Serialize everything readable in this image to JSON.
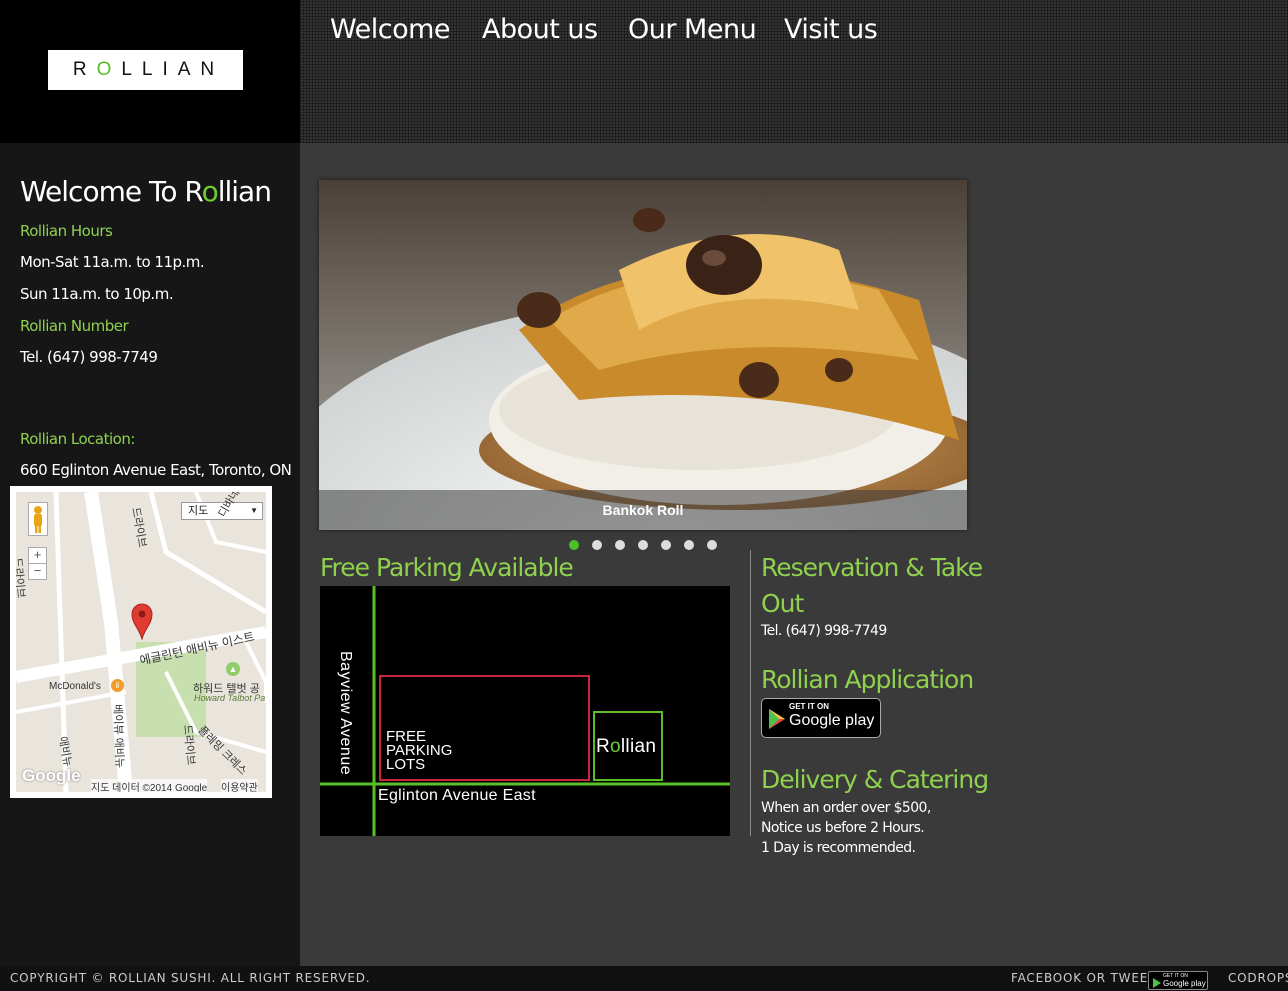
{
  "header": {
    "logo_text_pre": "R",
    "logo_text_o": "O",
    "logo_text_post": "LLIAN",
    "nav": [
      "Welcome",
      "About us",
      "Our Menu",
      "Visit us"
    ]
  },
  "sidebar": {
    "title_pre": "Welcome To R",
    "title_o": "o",
    "title_post": "llian",
    "hours_label": "Rollian Hours",
    "hours_1": "Mon-Sat 11a.m. to 11p.m.",
    "hours_2": "Sun 11a.m. to 10p.m.",
    "number_label": "Rollian Number",
    "phone": "Tel. (647) 998-7749",
    "location_label": "Rollian Location:",
    "address": "660 Eglinton Avenue East, Toronto, ON"
  },
  "map": {
    "type_select": "지도",
    "zoom_in": "+",
    "zoom_out": "−",
    "labels": [
      "드라이브",
      "디바네일",
      "에글린턴 애비뉴 이스트",
      "McDonald's",
      "하워드 텔벗 공",
      "Howard Talbot Pa",
      "베이뷰 애비뉴",
      "플레밍 크레스",
      "드라이브",
      "드라이브",
      "애비뉴"
    ],
    "logo": "Google",
    "attribution": "지도 데이터 ©2014 Google",
    "terms": "이용약관"
  },
  "slider": {
    "caption": "Bankok Roll",
    "dots": 7,
    "active_dot": 0
  },
  "parking": {
    "title": "Free Parking Available",
    "street_vertical": "Bayview Avenue",
    "street_horizontal": "Eglinton Avenue East",
    "lots_line1": "FREE",
    "lots_line2": "PARKING",
    "lots_line3": "LOTS",
    "brand_pre": "R",
    "brand_o": "o",
    "brand_post": "llian"
  },
  "reservation": {
    "title_line1": "Reservation & Take",
    "title_line2": "Out",
    "phone": "Tel. (647) 998-7749"
  },
  "application": {
    "title": "Rollian Application",
    "badge_small": "GET IT ON",
    "badge_large": "Google play"
  },
  "delivery": {
    "title": "Delivery & Catering",
    "line1": "When an order over $500,",
    "line2": "Notice us before 2 Hours.",
    "line3": "1 Day is recommended."
  },
  "footer": {
    "copyright": "COPYRIGHT © ROLLIAN SUSHI. ALL RIGHT RESERVED.",
    "social": "FACEBOOK OR TWEET",
    "badge_small": "GET IT ON",
    "badge_large": "Google play",
    "codrops": "CODROPS"
  },
  "colors": {
    "accent": "#8fd14f",
    "active_dot": "#4cc02b",
    "sidebar_bg": "#161616",
    "content_bg": "#3a3a3a"
  }
}
